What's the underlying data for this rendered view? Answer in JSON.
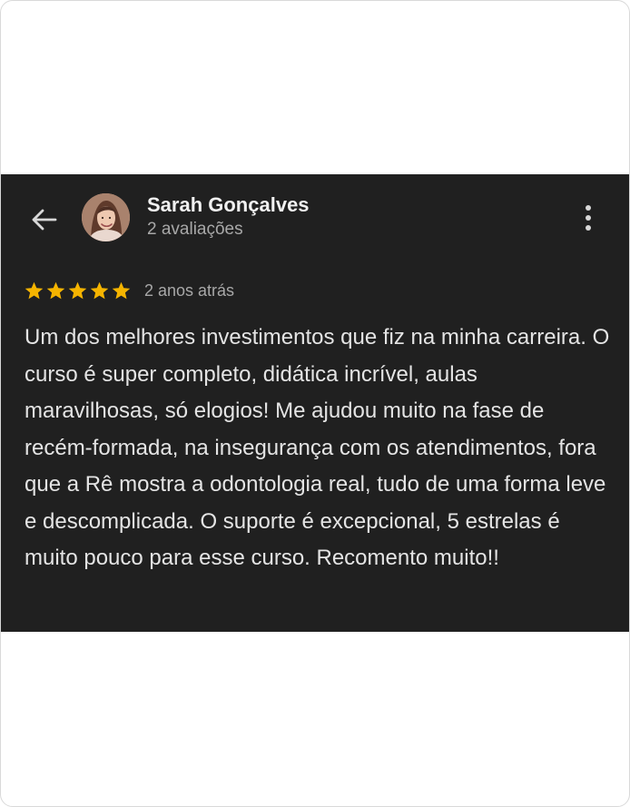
{
  "review": {
    "reviewer_name": "Sarah Gonçalves",
    "reviewer_meta": "2 avaliações",
    "avatar_alt": "Sarah Gonçalves",
    "rating": 5,
    "rating_max": 5,
    "date": "2 anos atrás",
    "text": "Um dos melhores investimentos que fiz na minha carreira. O curso é super completo, didática incrível, aulas maravilhosas, só elogios! Me ajudou muito na fase de recém-formada, na insegurança com os atendimentos, fora que a Rê mostra a odontologia real, tudo de uma forma leve e descomplicada. O suporte é excepcional, 5 estrelas é muito pouco para esse curso. Recomento muito!!"
  },
  "icons": {
    "back": "arrow-left-icon",
    "more": "more-vertical-icon",
    "star": "star-icon"
  },
  "colors": {
    "page_background": "#ffffff",
    "card_background": "#202020",
    "star": "#f5b400",
    "name": "#f1f1f1",
    "meta": "#a8a8a8",
    "body_text": "#e4e4e4"
  }
}
